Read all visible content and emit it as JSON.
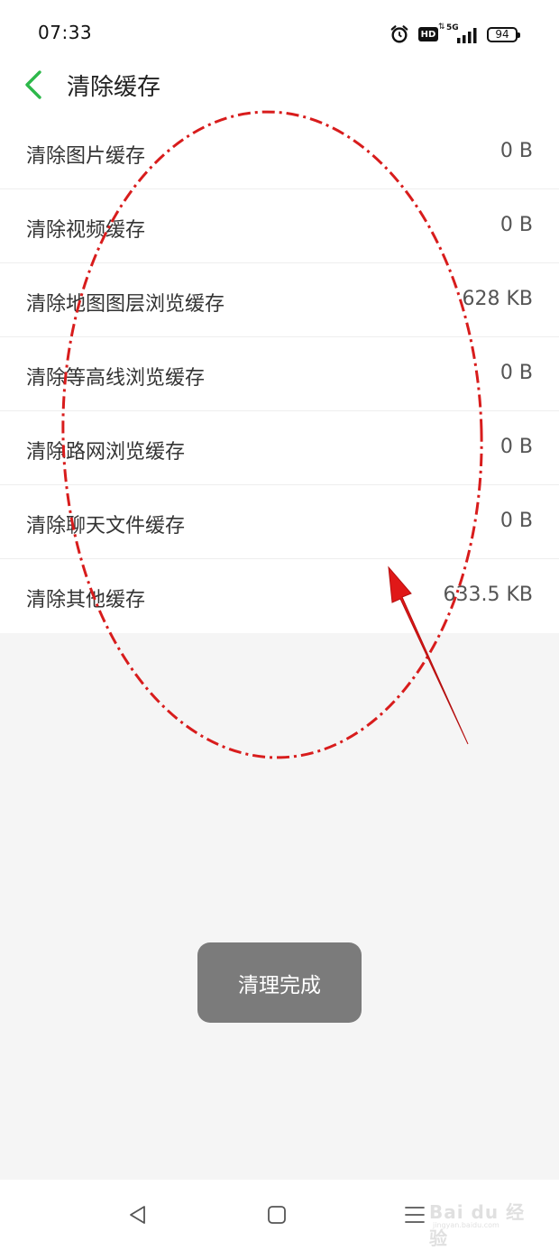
{
  "status_bar": {
    "time": "07:33",
    "hd_label": "HD",
    "network_label": "5G",
    "battery_level": "94",
    "icons": [
      "alarm-icon",
      "hd-badge",
      "5g-signal-icon",
      "battery-icon"
    ]
  },
  "header": {
    "back_icon": "chevron-left-icon",
    "title": "清除缓存",
    "accent_color": "#2db84a"
  },
  "cache_items": [
    {
      "label": "清除图片缓存",
      "size": "0 B"
    },
    {
      "label": "清除视频缓存",
      "size": "0 B"
    },
    {
      "label": "清除地图图层浏览缓存",
      "size": "628 KB"
    },
    {
      "label": "清除等高线浏览缓存",
      "size": "0 B"
    },
    {
      "label": "清除路网浏览缓存",
      "size": "0 B"
    },
    {
      "label": "清除聊天文件缓存",
      "size": "0 B"
    },
    {
      "label": "清除其他缓存",
      "size": "633.5 KB"
    }
  ],
  "toast": {
    "message": "清理完成"
  },
  "nav_bar": {
    "icons": [
      "back-triangle-icon",
      "home-square-icon",
      "menu-lines-icon"
    ]
  },
  "watermark": {
    "main": "Bai du 经验",
    "sub": "jingyan.baidu.com"
  },
  "annotation": {
    "color": "#e01818",
    "shapes": [
      "dashed-ellipse",
      "arrow"
    ]
  }
}
